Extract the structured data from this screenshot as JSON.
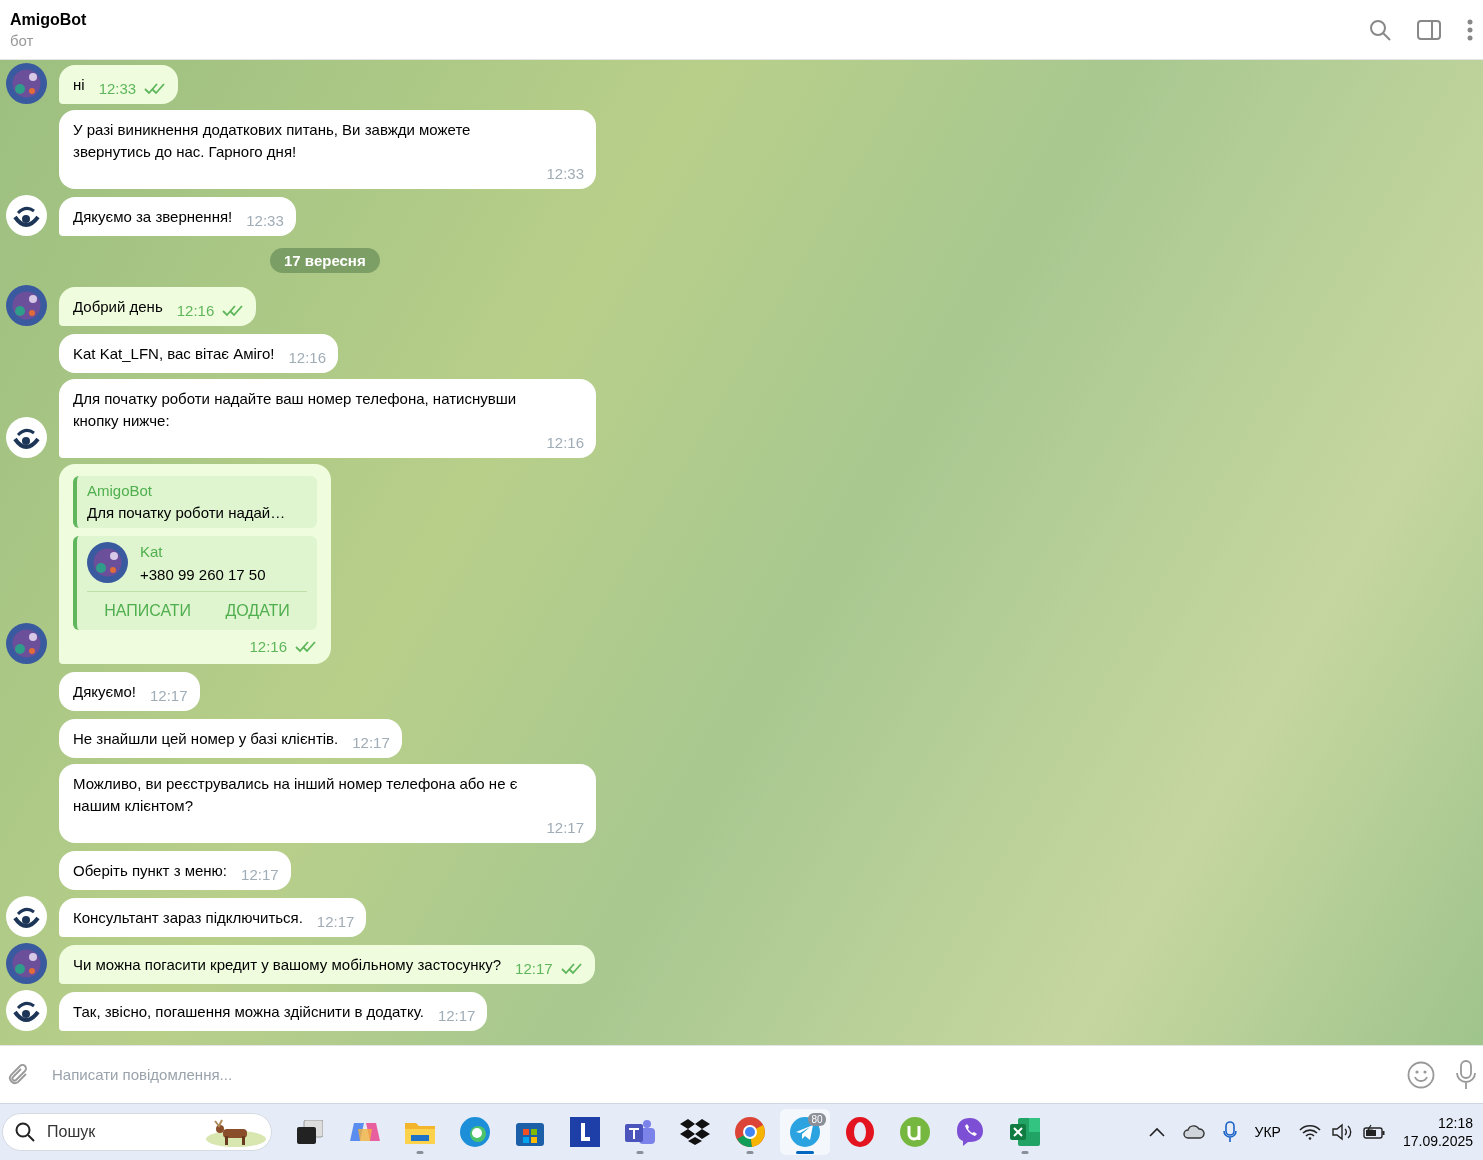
{
  "header": {
    "title": "AmigoBot",
    "subtitle": "бот"
  },
  "messages": [
    {
      "kind": "out",
      "text": "ні",
      "time": "12:33",
      "read": true
    },
    {
      "kind": "in",
      "text": "У разі виникнення додаткових питань, Ви завжди можете звернутись до нас. Гарного дня!",
      "time": "12:33"
    },
    {
      "kind": "in",
      "text": "Дякуємо за звернення!",
      "time": "12:33"
    },
    {
      "kind": "date",
      "text": "17 вересня"
    },
    {
      "kind": "out",
      "text": "Добрий день",
      "time": "12:16",
      "read": true
    },
    {
      "kind": "in",
      "text": "Kat Kat_LFN, вас вітає Аміго!",
      "time": "12:16"
    },
    {
      "kind": "in",
      "text": "Для початку роботи надайте ваш номер телефона, натиснувши кнопку нижче:",
      "time": "12:16"
    },
    {
      "kind": "contact",
      "reply_author": "AmigoBot",
      "reply_text": "Для початку роботи надай…",
      "contact_name": "Kat",
      "phone": "+380 99 260 17 50",
      "actions": [
        "НАПИСАТИ",
        "ДОДАТИ"
      ],
      "time": "12:16",
      "read": true
    },
    {
      "kind": "in",
      "text": "Дякуємо!",
      "time": "12:17"
    },
    {
      "kind": "in",
      "text": "Не знайшли цей номер у базі клієнтів.",
      "time": "12:17"
    },
    {
      "kind": "in",
      "text": "Можливо, ви реєструвались на інший номер телефона або не є нашим клієнтом?",
      "time": "12:17"
    },
    {
      "kind": "in",
      "text": "Оберіть пункт з меню:",
      "time": "12:17"
    },
    {
      "kind": "in",
      "text": "Консультант зараз підключиться.",
      "time": "12:17"
    },
    {
      "kind": "out",
      "text": "Чи можна погасити кредит у вашому мобільному застосунку?",
      "time": "12:17",
      "read": true
    },
    {
      "kind": "in",
      "text": "Так, звісно, погашення можна здійснити в додатку.",
      "time": "12:17"
    }
  ],
  "composer": {
    "placeholder": "Написати повідомлення..."
  },
  "taskbar": {
    "search_placeholder": "Пошук",
    "apps": [
      {
        "kind": "taskview",
        "running": false,
        "active": false
      },
      {
        "kind": "copilot",
        "running": false,
        "active": false
      },
      {
        "kind": "files",
        "running": true,
        "active": false
      },
      {
        "kind": "edge",
        "running": false,
        "active": false
      },
      {
        "kind": "store",
        "running": false,
        "active": false
      },
      {
        "kind": "letter",
        "running": false,
        "active": false
      },
      {
        "kind": "teams",
        "running": true,
        "active": false
      },
      {
        "kind": "dropbox",
        "running": false,
        "active": false
      },
      {
        "kind": "chrome",
        "running": true,
        "active": false
      },
      {
        "kind": "telegram",
        "running": true,
        "active": true,
        "badge": "80"
      },
      {
        "kind": "opera",
        "running": false,
        "active": false
      },
      {
        "kind": "torrent",
        "running": false,
        "active": false
      },
      {
        "kind": "viber",
        "running": false,
        "active": false
      },
      {
        "kind": "excel",
        "running": true,
        "active": false
      }
    ],
    "language": "УКР",
    "time": "12:18",
    "date": "17.09.2025"
  }
}
